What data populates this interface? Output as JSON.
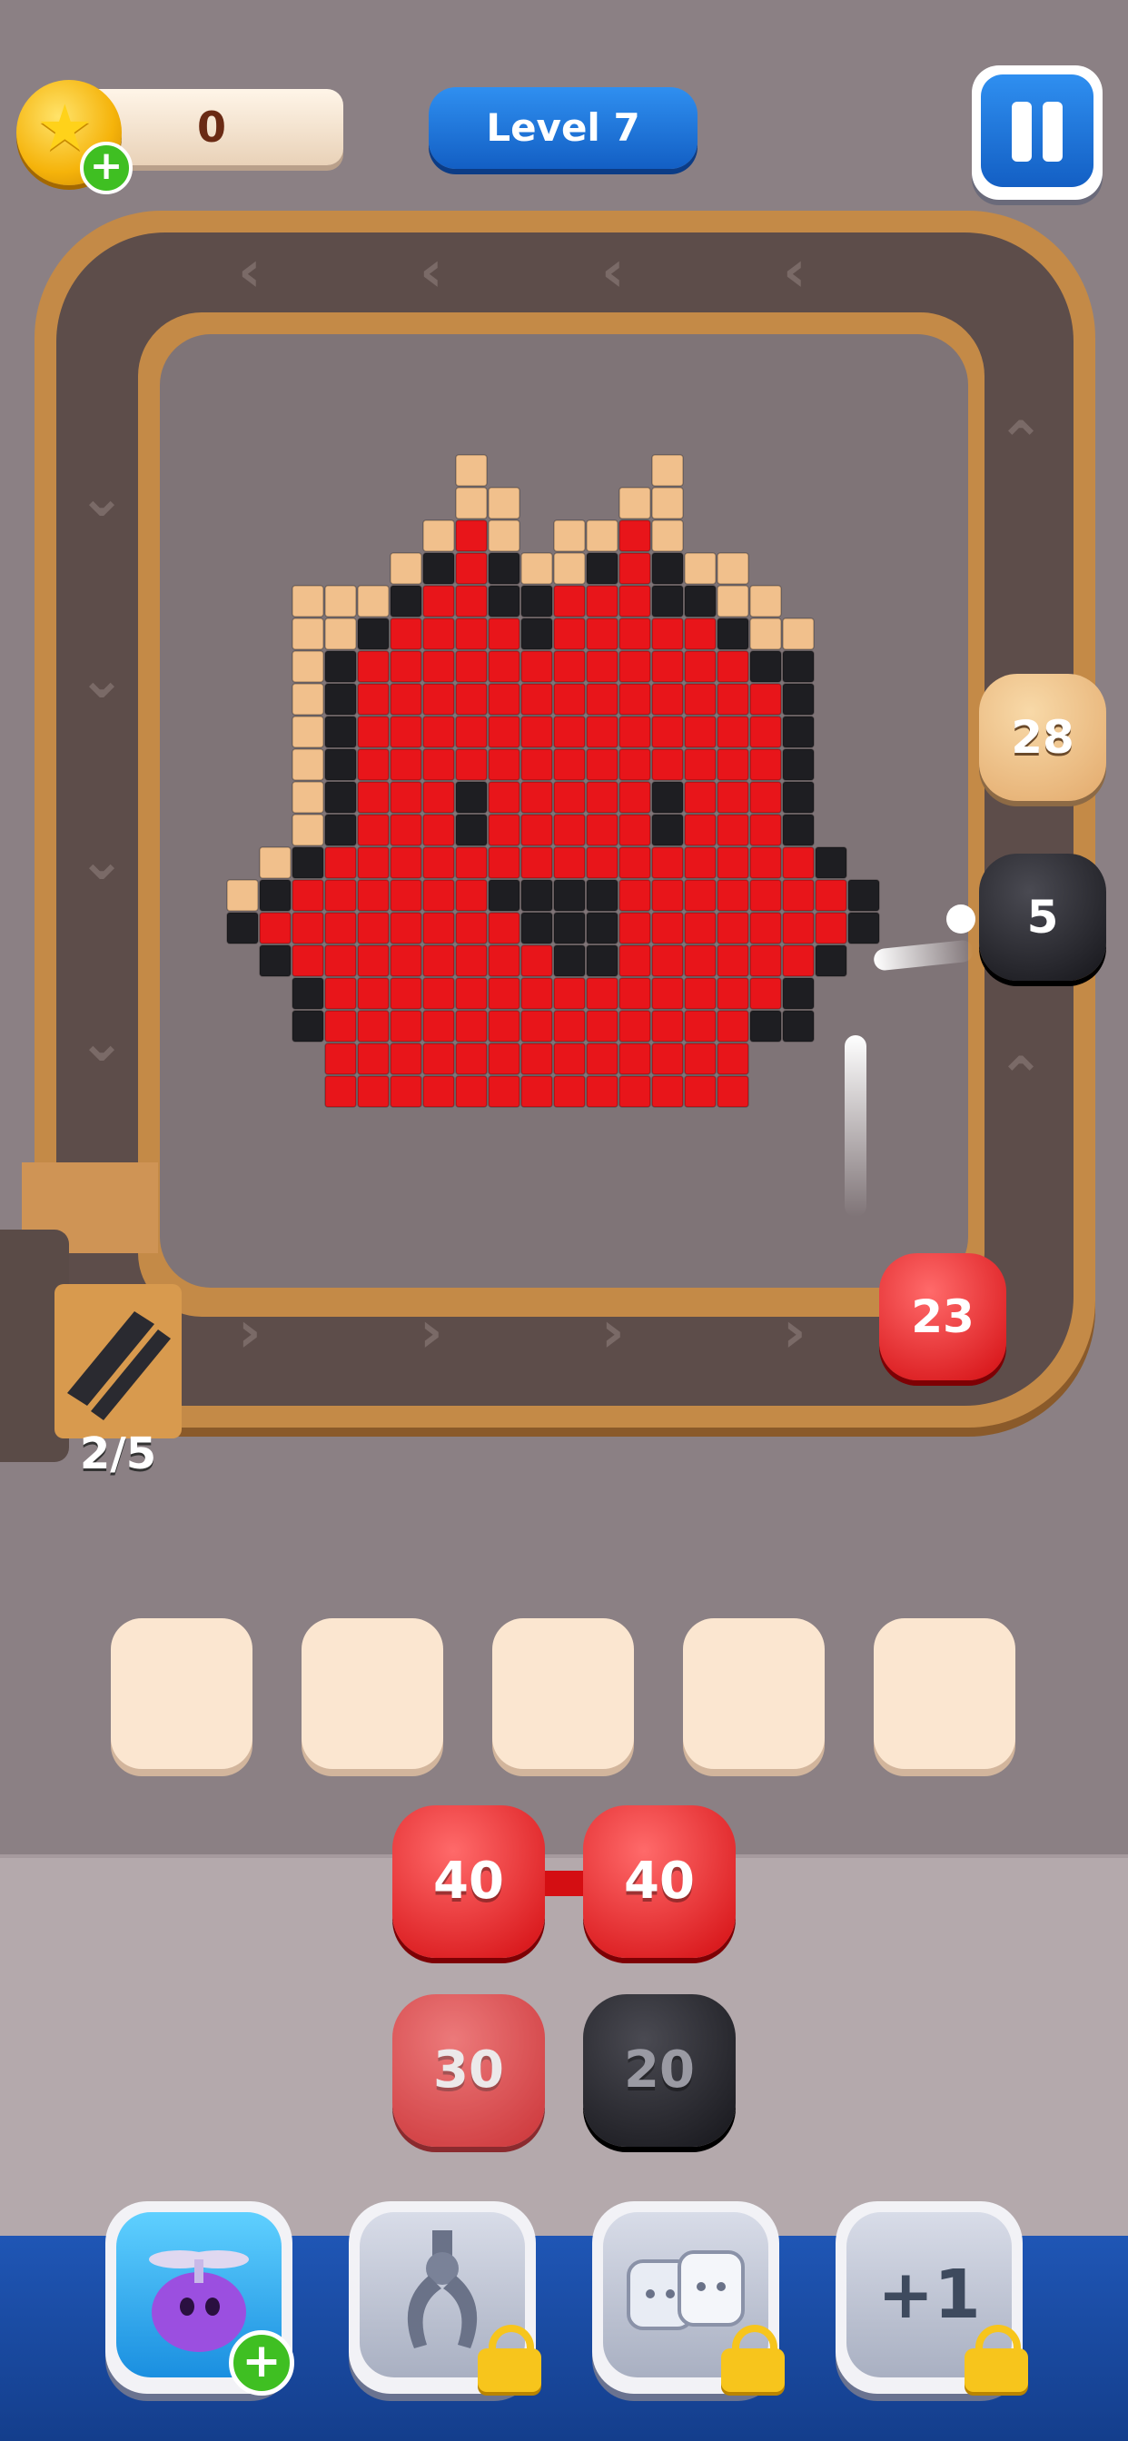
{
  "header": {
    "coins": "0",
    "coin_icon": "star-coin-icon",
    "level_label": "Level 7",
    "pause_icon": "pause-icon"
  },
  "conveyor": {
    "shooters": [
      {
        "value": "28",
        "color": "#e8b57a"
      },
      {
        "value": "5",
        "color": "#1e1e24"
      },
      {
        "value": "23",
        "color": "#e0161b"
      }
    ],
    "capacity": "2/5"
  },
  "pixel_art": {
    "palette": {
      "K": "#1e1e22",
      "R": "#e8151a",
      "T": "#f1c08c"
    },
    "rows": [
      "........T.....T.......",
      "........TT...TT.......",
      ".......TRT.TTRT.......",
      "......TKRKTTKRKTT.....",
      "...TTTKRRKKRRRKKTT....",
      "...TTKRRRRKRRRRRKTT...",
      "...TKRRRRRRRRRRRRKK...",
      "...TKRRRRRRRRRRRRRK...",
      "...TKRRRRRRRRRRRRRK...",
      "...TKRRRRRRRRRRRRRK...",
      "...TKRRRKRRRRRKRRRK...",
      "...TKRRRKRRRRRKRRRK...",
      "..TKRRRRRRRRRRRRRRRK..",
      ".TKRRRRRRKKKKRRRRRRRK.",
      ".KRRRRRRRRKKKRRRRRRRK.",
      "..KRRRRRRRRKKRRRRRRK..",
      "...KRRRRRRRRRRRRRRK...",
      "...KRRRRRRRRRRRRRKK...",
      "....RRRRRRRRRRRRR.....",
      "....RRRRRRRRRRRRR....."
    ]
  },
  "slots": [
    {
      "id": 1
    },
    {
      "id": 2
    },
    {
      "id": 3
    },
    {
      "id": 4
    },
    {
      "id": 5
    }
  ],
  "queue": [
    {
      "value": "40",
      "color": "red"
    },
    {
      "value": "40",
      "color": "red"
    },
    {
      "value": "30",
      "color": "red"
    },
    {
      "value": "20",
      "color": "black"
    }
  ],
  "boosters": [
    {
      "name": "fan-slime-booster",
      "icon": "fan-slime-icon",
      "locked": false,
      "label": ""
    },
    {
      "name": "claw-booster",
      "icon": "claw-icon",
      "locked": true,
      "label": ""
    },
    {
      "name": "ice-cubes-booster",
      "icon": "ice-cubes-icon",
      "locked": true,
      "label": ""
    },
    {
      "name": "plus-one-booster",
      "icon": "plus-one-icon",
      "locked": true,
      "label": "+1"
    }
  ]
}
